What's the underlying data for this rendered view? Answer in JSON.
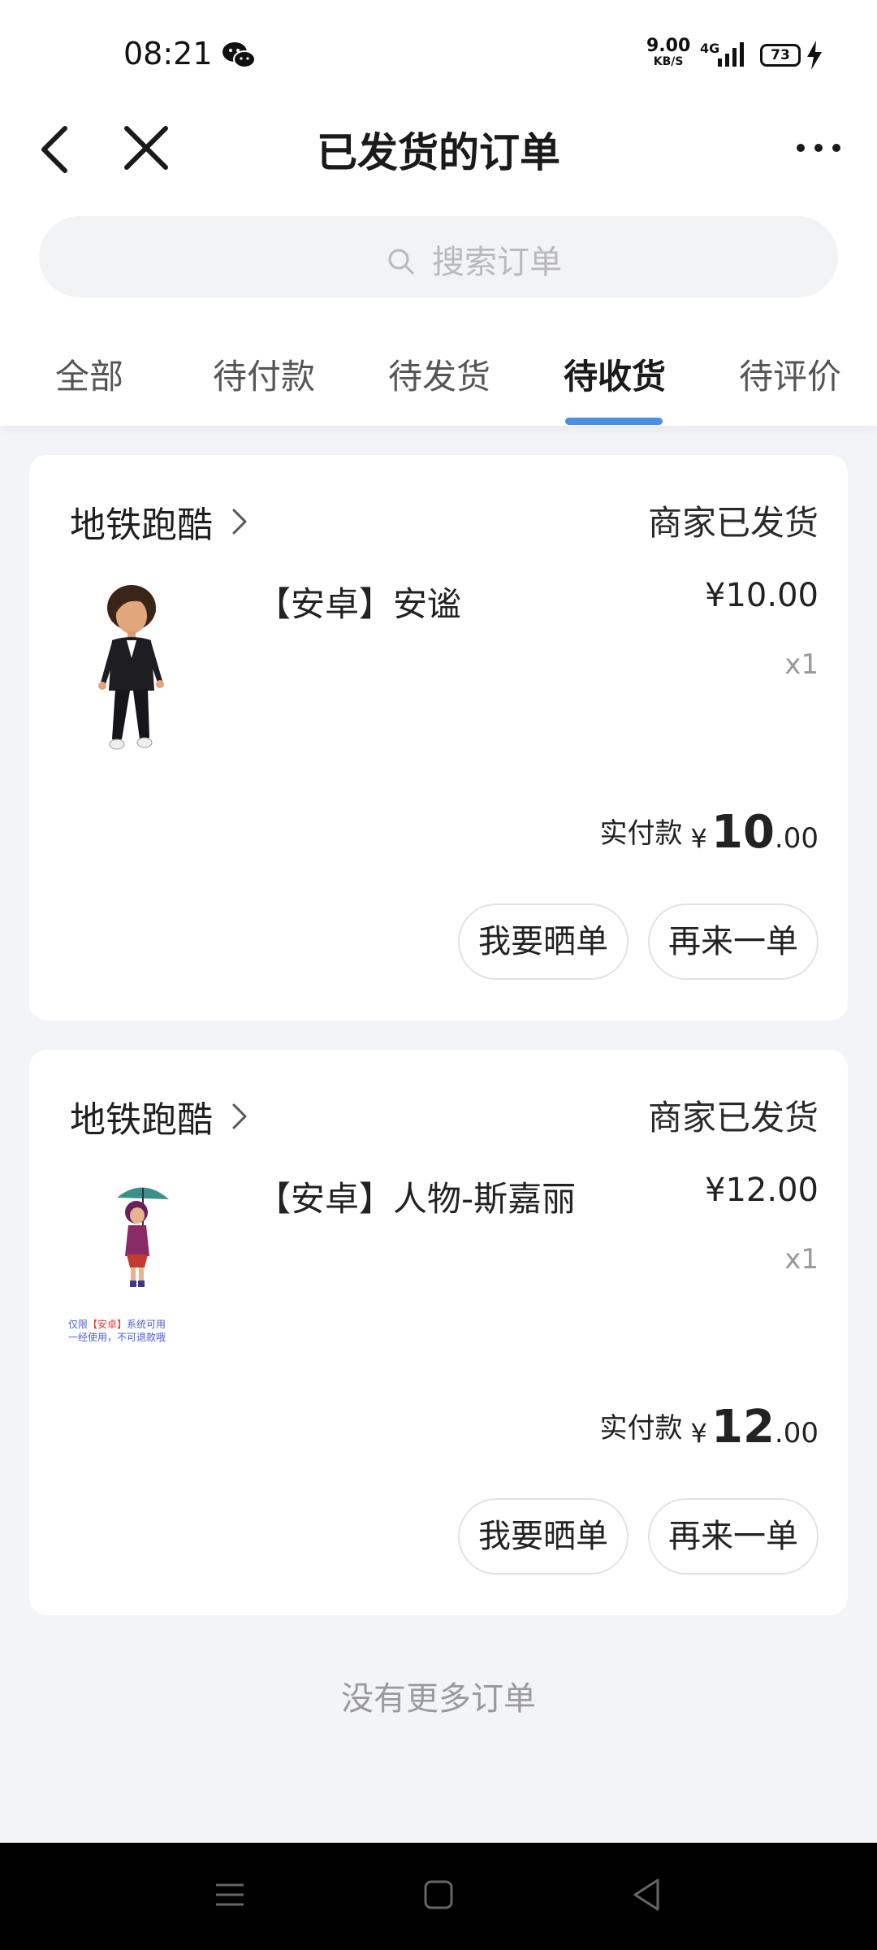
{
  "status_bar": {
    "time": "08:21",
    "net_speed": "9.00",
    "net_speed_unit": "KB/S",
    "network": "4G",
    "battery": "73"
  },
  "header": {
    "title": "已发货的订单",
    "back_icon": "chevron-left-icon",
    "close_icon": "close-icon",
    "more_icon": "more-icon"
  },
  "search": {
    "placeholder": "搜索订单"
  },
  "tabs": [
    {
      "label": "全部",
      "active": false
    },
    {
      "label": "待付款",
      "active": false
    },
    {
      "label": "待发货",
      "active": false
    },
    {
      "label": "待收货",
      "active": true
    },
    {
      "label": "待评价",
      "active": false
    }
  ],
  "orders": [
    {
      "shop": "地铁跑酷",
      "status": "商家已发货",
      "product": "【安卓】安谧",
      "price": "¥10.00",
      "qty": "x1",
      "paid_label": "实付款",
      "paid_yen": "¥",
      "paid_int": "10",
      "paid_dec": ".00",
      "btn_review": "我要晒单",
      "btn_reorder": "再来一单"
    },
    {
      "shop": "地铁跑酷",
      "status": "商家已发货",
      "product": "【安卓】人物-斯嘉丽",
      "price": "¥12.00",
      "qty": "x1",
      "paid_label": "实付款",
      "paid_yen": "¥",
      "paid_int": "12",
      "paid_dec": ".00",
      "btn_review": "我要晒单",
      "btn_reorder": "再来一单",
      "thumb_caption_line1_pre": "仅限",
      "thumb_caption_line1_hl": "【安卓】",
      "thumb_caption_line1_post": "系统可用",
      "thumb_caption_line2": "一经使用，不可退款哦"
    }
  ],
  "footer": {
    "no_more": "没有更多订单"
  },
  "colors": {
    "accent": "#4a8ee8",
    "background": "#f3f4f7",
    "card": "#ffffff"
  }
}
